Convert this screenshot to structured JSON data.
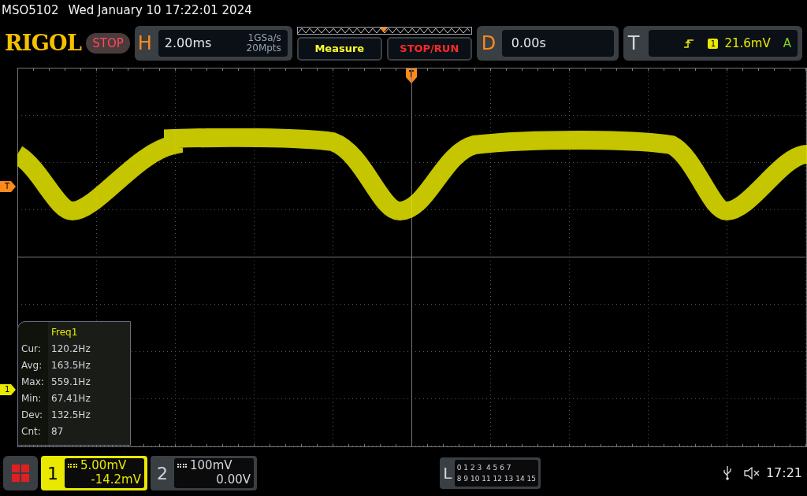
{
  "header": {
    "model": "MSO5102",
    "datetime": "Wed January 10 17:22:01 2024"
  },
  "toolbar": {
    "logo": "RIGOL",
    "run_state": "STOP",
    "horizontal": {
      "label": "H",
      "timebase": "2.00ms",
      "sample_rate": "1GSa/s",
      "memory_depth": "20Mpts"
    },
    "buttons": [
      {
        "label": "Measure",
        "kind": "measure"
      },
      {
        "label": "STOP/RUN",
        "kind": "stoprun"
      }
    ],
    "delay": {
      "label": "D",
      "value": "0.00s"
    },
    "trigger": {
      "label": "T",
      "source": "1",
      "level": "21.6mV",
      "mode": "A"
    }
  },
  "markers": [
    {
      "label": "T",
      "kind": "trigger"
    },
    {
      "label": "1",
      "kind": "channel"
    }
  ],
  "measurement": {
    "title": "Freq1",
    "rows": [
      {
        "label": "Cur:",
        "value": "120.2Hz"
      },
      {
        "label": "Avg:",
        "value": "163.5Hz"
      },
      {
        "label": "Max:",
        "value": "559.1Hz"
      },
      {
        "label": "Min:",
        "value": "67.41Hz"
      },
      {
        "label": "Dev:",
        "value": "132.5Hz"
      },
      {
        "label": "Cnt:",
        "value": "87"
      }
    ]
  },
  "channels": [
    {
      "number": "1",
      "scale": "5.00mV",
      "offset": "-14.2mV",
      "selected": true
    },
    {
      "number": "2",
      "scale": "100mV",
      "offset": "0.00V",
      "selected": false
    }
  ],
  "logic": {
    "label": "L",
    "rows": [
      "0 1 2 3  4 5 6 7",
      "8 9 10 11 12 13 14 15"
    ]
  },
  "status": {
    "time": "17:21"
  }
}
